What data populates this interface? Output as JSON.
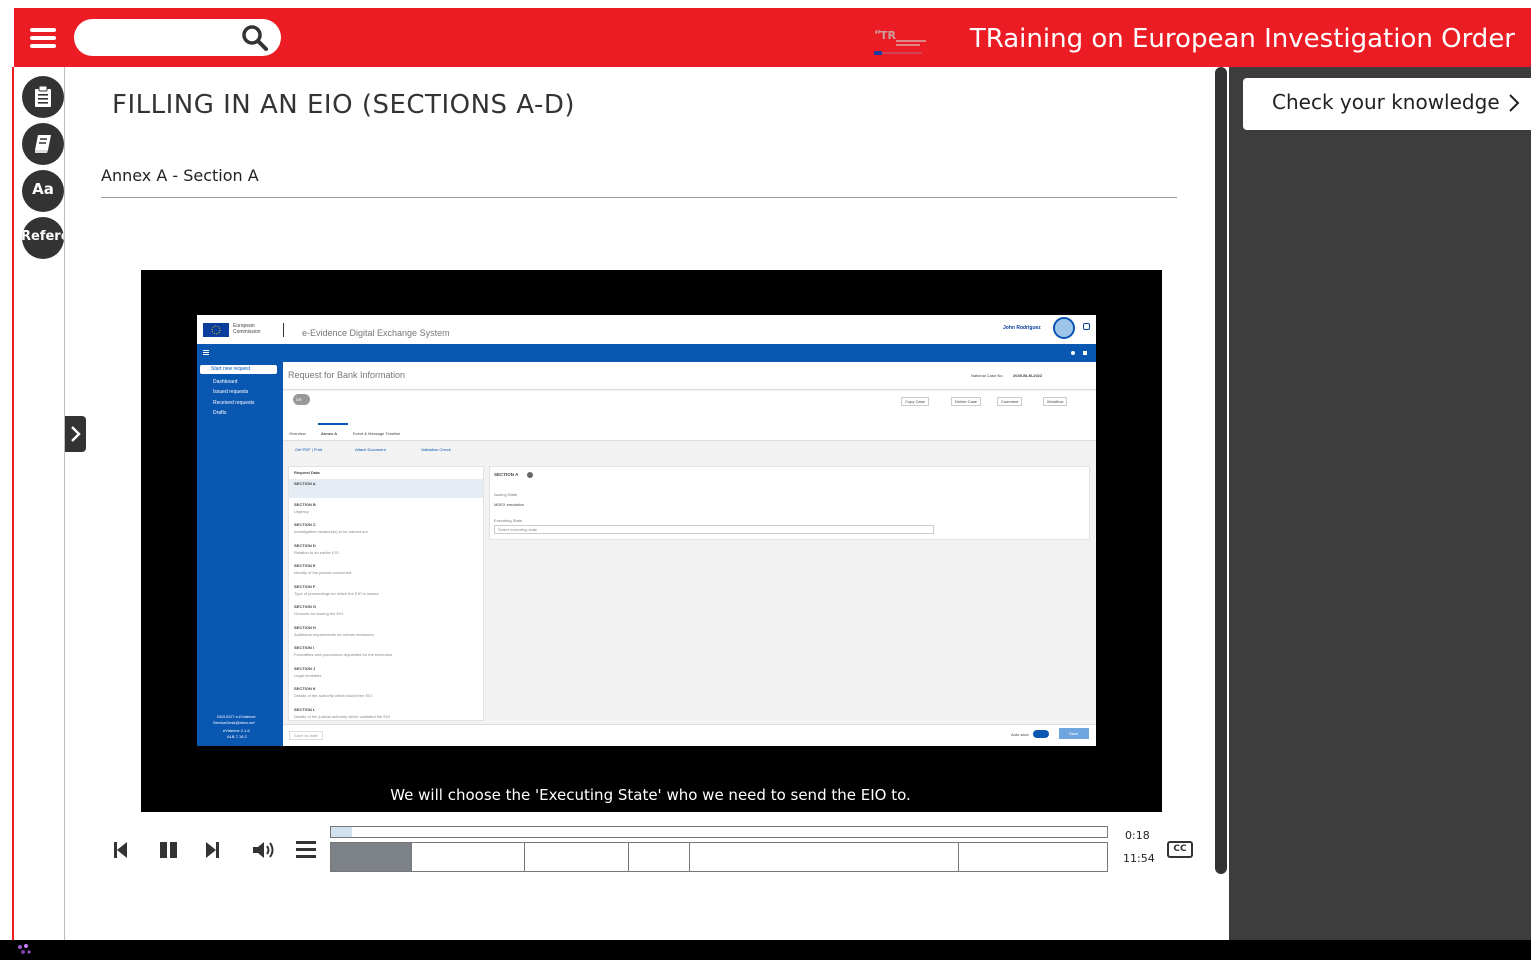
{
  "header": {
    "site_title": "TRaining on European Investigation Order",
    "search_placeholder": "",
    "logo_text": "TR"
  },
  "rail": {
    "reference_label": "Refere",
    "text_size_label": "Aa"
  },
  "content": {
    "page_title": "FILLING IN AN EIO (SECTIONS A-D)",
    "section_title": "Annex A - Section A"
  },
  "video": {
    "subtitle": "We will choose the 'Executing State' who we need to send the EIO to.",
    "app": {
      "brand_line1": "European",
      "brand_line2": "Commission",
      "system_name": "e-Evidence Digital Exchange System",
      "user_name": "John Rodriguez",
      "page_heading": "Request for Bank Information",
      "national_case_label": "National Case No.",
      "national_case_value": "2049-BLM-2022",
      "side_items": [
        "Start new request",
        "Dashboard",
        "Issued requests",
        "Received requests",
        "Drafts"
      ],
      "side_footer": [
        "DIGLEGT e-Evidence",
        "ServiceDesk@ahxx.net",
        "eVidence 2.1.6",
        "ALB 7.18.2"
      ],
      "actions": [
        "Copy Case",
        "Delete Case",
        "Comment",
        "Workflow"
      ],
      "tabs": [
        "Overview",
        "Annex A",
        "Event & Message Timeline"
      ],
      "toolbar": [
        "Get PDF | Print",
        "Attach Document",
        "Validation Check"
      ],
      "request_fields_title": "Request Data",
      "sections": [
        {
          "name": "SECTION A",
          "desc": ""
        },
        {
          "name": "SECTION B",
          "desc": "Urgency"
        },
        {
          "name": "SECTION C",
          "desc": "Investigative measure(s) to be carried out"
        },
        {
          "name": "SECTION D",
          "desc": "Relation to an earlier EIO"
        },
        {
          "name": "SECTION E",
          "desc": "Identity of the person concerned"
        },
        {
          "name": "SECTION F",
          "desc": "Type of proceedings for which the EIO is issued"
        },
        {
          "name": "SECTION G",
          "desc": "Grounds for issuing the EIO"
        },
        {
          "name": "SECTION H",
          "desc": "Additional requirements for certain measures"
        },
        {
          "name": "SECTION I",
          "desc": "Formalities and procedures requested for the execution"
        },
        {
          "name": "SECTION J",
          "desc": "Legal remedies"
        },
        {
          "name": "SECTION K",
          "desc": "Details of the authority which issued the EIO"
        },
        {
          "name": "SECTION L",
          "desc": "Details of the judicial authority which validated the EIO"
        }
      ],
      "form_section_title": "SECTION A",
      "issuing_state_label": "Issuing State",
      "issuing_state_value": "MDEX emulation",
      "executing_state_label": "Executing State",
      "executing_state_placeholder": "Select executing state",
      "bottom_left": "Save as draft",
      "auto_save_label": "Auto save",
      "save_label": "Save",
      "badge": "DR"
    }
  },
  "player": {
    "current_time": "0:18",
    "total_time": "11:54",
    "cc_label": "CC",
    "progress": 0.027,
    "chapters_count": 6
  },
  "sidebar": {
    "knowledge_button": "Check your knowledge"
  },
  "colors": {
    "brand_red": "#ec1c24",
    "app_blue": "#0a57b2",
    "panel_dark": "#3d3d3d"
  }
}
